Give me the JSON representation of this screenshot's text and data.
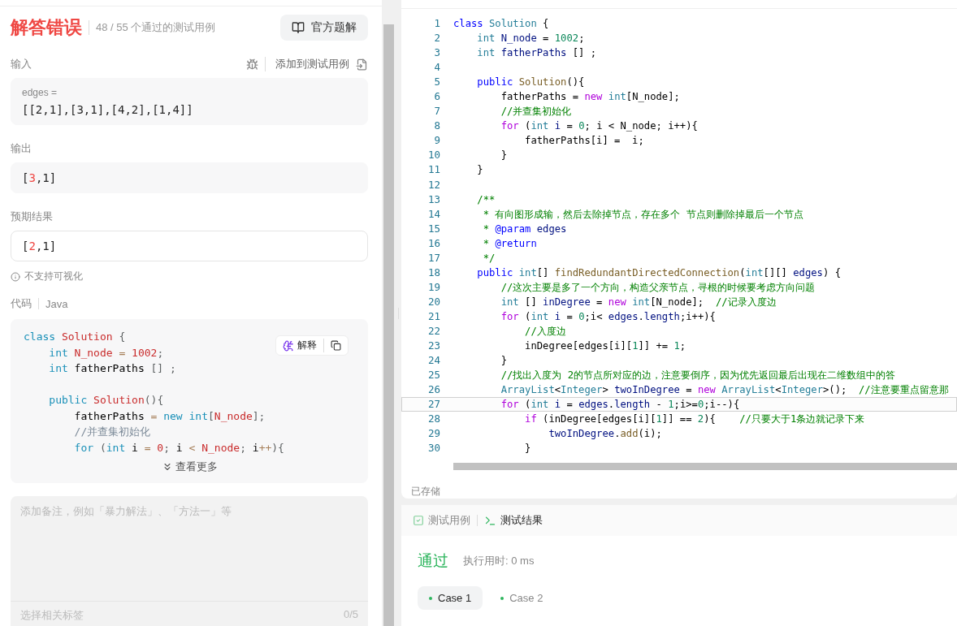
{
  "left": {
    "verdict": "解答错误",
    "passed": "48 / 55 个通过的测试用例",
    "solution_button": "官方题解",
    "input": {
      "label": "输入",
      "add_label": "添加到测试用例",
      "var": "edges =",
      "value": "[[2,1],[3,1],[4,2],[1,4]]"
    },
    "output": {
      "label": "输出",
      "parts": [
        {
          "text": "[",
          "wrong": false
        },
        {
          "text": "3",
          "wrong": true
        },
        {
          "text": ",1]",
          "wrong": false
        }
      ]
    },
    "expected": {
      "label": "预期结果",
      "parts": [
        {
          "text": "[",
          "wrong": false
        },
        {
          "text": "2",
          "wrong": true
        },
        {
          "text": ",1]",
          "wrong": false
        }
      ]
    },
    "no_visual": "不支持可视化",
    "code_label": "代码",
    "language": "Java",
    "explain_button": "解释",
    "snippet": [
      {
        "kind": "code",
        "tokens": [
          {
            "kind": "kw",
            "text": "class"
          },
          {
            "kind": "fn",
            "text": " Solution"
          },
          {
            "kind": "pn",
            "text": " {"
          }
        ]
      },
      {
        "kind": "code",
        "tokens": [
          {
            "kind": "kw",
            "text": "    int"
          },
          {
            "kind": "fn",
            "text": " N_node"
          },
          {
            "kind": "op",
            "text": " = "
          },
          {
            "kind": "num",
            "text": "1002"
          },
          {
            "kind": "pn",
            "text": ";"
          }
        ]
      },
      {
        "kind": "code",
        "tokens": [
          {
            "kind": "kw",
            "text": "    int"
          },
          {
            "kind": "p",
            "text": " fatherPaths "
          },
          {
            "kind": "pn",
            "text": "[] ;"
          }
        ]
      },
      {
        "kind": "blank"
      },
      {
        "kind": "code",
        "tokens": [
          {
            "kind": "kw",
            "text": "    public"
          },
          {
            "kind": "fn",
            "text": " Solution"
          },
          {
            "kind": "pn",
            "text": "(){"
          }
        ]
      },
      {
        "kind": "code",
        "tokens": [
          {
            "kind": "p",
            "text": "        fatherPaths "
          },
          {
            "kind": "op",
            "text": "="
          },
          {
            "kind": "kw",
            "text": " new"
          },
          {
            "kind": "kw",
            "text": " int"
          },
          {
            "kind": "pn",
            "text": "["
          },
          {
            "kind": "fn",
            "text": "N_node"
          },
          {
            "kind": "pn",
            "text": "];"
          }
        ]
      },
      {
        "kind": "code",
        "tokens": [
          {
            "kind": "cm",
            "text": "        //并查集初始化"
          }
        ]
      },
      {
        "kind": "code",
        "tokens": [
          {
            "kind": "kw",
            "text": "        for"
          },
          {
            "kind": "pn",
            "text": " ("
          },
          {
            "kind": "kw",
            "text": "int"
          },
          {
            "kind": "p",
            "text": " i "
          },
          {
            "kind": "op",
            "text": "="
          },
          {
            "kind": "num",
            "text": " 0"
          },
          {
            "kind": "pn",
            "text": ";"
          },
          {
            "kind": "p",
            "text": " i "
          },
          {
            "kind": "op",
            "text": "<"
          },
          {
            "kind": "fn",
            "text": " N_node"
          },
          {
            "kind": "pn",
            "text": ";"
          },
          {
            "kind": "p",
            "text": " i"
          },
          {
            "kind": "op",
            "text": "++"
          },
          {
            "kind": "pn",
            "text": "){"
          }
        ]
      }
    ],
    "more": "查看更多",
    "note_placeholder": "添加备注，例如「暴力解法」、「方法一」等",
    "tags_placeholder": "选择相关标签",
    "tags_count": "0/5"
  },
  "editor": {
    "lines": [
      {
        "num": "1",
        "highlighted": false,
        "tokens": [
          {
            "kind": "kw",
            "text": "class"
          },
          {
            "kind": "type",
            "text": " Solution"
          },
          {
            "kind": "p",
            "text": " {"
          }
        ]
      },
      {
        "num": "2",
        "highlighted": false,
        "tokens": [
          {
            "kind": "type",
            "text": "    int"
          },
          {
            "kind": "var",
            "text": " N_node"
          },
          {
            "kind": "p",
            "text": " = "
          },
          {
            "kind": "num",
            "text": "1002"
          },
          {
            "kind": "p",
            "text": ";"
          }
        ]
      },
      {
        "num": "3",
        "highlighted": false,
        "tokens": [
          {
            "kind": "type",
            "text": "    int"
          },
          {
            "kind": "var",
            "text": " fatherPaths"
          },
          {
            "kind": "p",
            "text": " [] ;"
          }
        ]
      },
      {
        "num": "4",
        "highlighted": false
      },
      {
        "num": "5",
        "highlighted": false,
        "tokens": [
          {
            "kind": "kw",
            "text": "    public"
          },
          {
            "kind": "fn",
            "text": " Solution"
          },
          {
            "kind": "p",
            "text": "(){"
          }
        ]
      },
      {
        "num": "6",
        "highlighted": false,
        "tokens": [
          {
            "kind": "p",
            "text": "        fatherPaths = "
          },
          {
            "kind": "ctl",
            "text": "new"
          },
          {
            "kind": "type",
            "text": " int"
          },
          {
            "kind": "p",
            "text": "[N_node];"
          }
        ]
      },
      {
        "num": "7",
        "highlighted": false,
        "tokens": [
          {
            "kind": "cm",
            "text": "        //并查集初始化"
          }
        ]
      },
      {
        "num": "8",
        "highlighted": false,
        "tokens": [
          {
            "kind": "ctl",
            "text": "        for"
          },
          {
            "kind": "p",
            "text": " ("
          },
          {
            "kind": "type",
            "text": "int"
          },
          {
            "kind": "var",
            "text": " i"
          },
          {
            "kind": "p",
            "text": " = "
          },
          {
            "kind": "num",
            "text": "0"
          },
          {
            "kind": "p",
            "text": "; i < N_node; i++){"
          }
        ]
      },
      {
        "num": "9",
        "highlighted": false,
        "tokens": [
          {
            "kind": "p",
            "text": "            fatherPaths[i] =  i;"
          }
        ]
      },
      {
        "num": "10",
        "highlighted": false,
        "tokens": [
          {
            "kind": "p",
            "text": "        }"
          }
        ]
      },
      {
        "num": "11",
        "highlighted": false,
        "tokens": [
          {
            "kind": "p",
            "text": "    }"
          }
        ]
      },
      {
        "num": "12",
        "highlighted": false
      },
      {
        "num": "13",
        "highlighted": false,
        "tokens": [
          {
            "kind": "cm",
            "text": "    /**"
          }
        ]
      },
      {
        "num": "14",
        "highlighted": false,
        "tokens": [
          {
            "kind": "cm",
            "text": "     * 有向图形成输，然后去除掉节点，存在多个 节点则删除掉最后一个节点"
          }
        ]
      },
      {
        "num": "15",
        "highlighted": false,
        "tokens": [
          {
            "kind": "cm",
            "text": "     * "
          },
          {
            "kind": "kw",
            "text": "@param"
          },
          {
            "kind": "var",
            "text": " edges"
          }
        ]
      },
      {
        "num": "16",
        "highlighted": false,
        "tokens": [
          {
            "kind": "cm",
            "text": "     * "
          },
          {
            "kind": "kw",
            "text": "@return"
          }
        ]
      },
      {
        "num": "17",
        "highlighted": false,
        "tokens": [
          {
            "kind": "cm",
            "text": "     */"
          }
        ]
      },
      {
        "num": "18",
        "highlighted": false,
        "tokens": [
          {
            "kind": "kw",
            "text": "    public"
          },
          {
            "kind": "type",
            "text": " int"
          },
          {
            "kind": "p",
            "text": "[] "
          },
          {
            "kind": "fn",
            "text": "findRedundantDirectedConnection"
          },
          {
            "kind": "p",
            "text": "("
          },
          {
            "kind": "type",
            "text": "int"
          },
          {
            "kind": "p",
            "text": "[][] "
          },
          {
            "kind": "var",
            "text": "edges"
          },
          {
            "kind": "p",
            "text": ") {"
          }
        ]
      },
      {
        "num": "19",
        "highlighted": false,
        "tokens": [
          {
            "kind": "cm",
            "text": "        //这次主要是多了一个方向，构造父亲节点，寻根的时候要考虑方向问题"
          }
        ]
      },
      {
        "num": "20",
        "highlighted": false,
        "tokens": [
          {
            "kind": "type",
            "text": "        int"
          },
          {
            "kind": "p",
            "text": " [] "
          },
          {
            "kind": "var",
            "text": "inDegree"
          },
          {
            "kind": "p",
            "text": " = "
          },
          {
            "kind": "ctl",
            "text": "new"
          },
          {
            "kind": "type",
            "text": " int"
          },
          {
            "kind": "p",
            "text": "[N_node];"
          },
          {
            "kind": "cm",
            "text": "  //记录入度边"
          }
        ]
      },
      {
        "num": "21",
        "highlighted": false,
        "tokens": [
          {
            "kind": "ctl",
            "text": "        for"
          },
          {
            "kind": "p",
            "text": " ("
          },
          {
            "kind": "type",
            "text": "int"
          },
          {
            "kind": "var",
            "text": " i"
          },
          {
            "kind": "p",
            "text": " = "
          },
          {
            "kind": "num",
            "text": "0"
          },
          {
            "kind": "p",
            "text": ";i< "
          },
          {
            "kind": "var",
            "text": "edges"
          },
          {
            "kind": "p",
            "text": "."
          },
          {
            "kind": "var",
            "text": "length"
          },
          {
            "kind": "p",
            "text": ";i++){"
          }
        ]
      },
      {
        "num": "22",
        "highlighted": false,
        "tokens": [
          {
            "kind": "cm",
            "text": "            //入度边"
          }
        ]
      },
      {
        "num": "23",
        "highlighted": false,
        "tokens": [
          {
            "kind": "p",
            "text": "            inDegree[edges[i]["
          },
          {
            "kind": "num",
            "text": "1"
          },
          {
            "kind": "p",
            "text": "]] += "
          },
          {
            "kind": "num",
            "text": "1"
          },
          {
            "kind": "p",
            "text": ";"
          }
        ]
      },
      {
        "num": "24",
        "highlighted": false,
        "tokens": [
          {
            "kind": "p",
            "text": "        }"
          }
        ]
      },
      {
        "num": "25",
        "highlighted": false,
        "tokens": [
          {
            "kind": "cm",
            "text": "        //找出入度为 2的节点所对应的边，注意要倒序，因为优先返回最后出现在二维数组中的答"
          }
        ]
      },
      {
        "num": "26",
        "highlighted": false,
        "tokens": [
          {
            "kind": "type",
            "text": "        ArrayList"
          },
          {
            "kind": "p",
            "text": "<"
          },
          {
            "kind": "type",
            "text": "Integer"
          },
          {
            "kind": "p",
            "text": "> "
          },
          {
            "kind": "var",
            "text": "twoInDegree"
          },
          {
            "kind": "p",
            "text": " = "
          },
          {
            "kind": "ctl",
            "text": "new"
          },
          {
            "kind": "type",
            "text": " ArrayList"
          },
          {
            "kind": "p",
            "text": "<"
          },
          {
            "kind": "type",
            "text": "Integer"
          },
          {
            "kind": "p",
            "text": ">();"
          },
          {
            "kind": "cm",
            "text": "  //注意要重点留意那"
          }
        ]
      },
      {
        "num": "27",
        "highlighted": true,
        "tokens": [
          {
            "kind": "ctl",
            "text": "        for"
          },
          {
            "kind": "p",
            "text": " ("
          },
          {
            "kind": "type",
            "text": "int"
          },
          {
            "kind": "var",
            "text": " i"
          },
          {
            "kind": "p",
            "text": " = "
          },
          {
            "kind": "var",
            "text": "edges"
          },
          {
            "kind": "p",
            "text": "."
          },
          {
            "kind": "var",
            "text": "length"
          },
          {
            "kind": "p",
            "text": " - "
          },
          {
            "kind": "num",
            "text": "1"
          },
          {
            "kind": "p",
            "text": ";i>="
          },
          {
            "kind": "num",
            "text": "0"
          },
          {
            "kind": "p",
            "text": ";i--){"
          }
        ]
      },
      {
        "num": "28",
        "highlighted": false,
        "tokens": [
          {
            "kind": "ctl",
            "text": "            if"
          },
          {
            "kind": "p",
            "text": " (inDegree[edges[i]["
          },
          {
            "kind": "num",
            "text": "1"
          },
          {
            "kind": "p",
            "text": "]] == "
          },
          {
            "kind": "num",
            "text": "2"
          },
          {
            "kind": "p",
            "text": "){"
          },
          {
            "kind": "cm",
            "text": "    //只要大于1条边就记录下来"
          }
        ]
      },
      {
        "num": "29",
        "highlighted": false,
        "tokens": [
          {
            "kind": "var",
            "text": "                twoInDegree"
          },
          {
            "kind": "p",
            "text": "."
          },
          {
            "kind": "fn",
            "text": "add"
          },
          {
            "kind": "p",
            "text": "(i);"
          }
        ]
      },
      {
        "num": "30",
        "highlighted": false,
        "tokens": [
          {
            "kind": "p",
            "text": "            }"
          }
        ]
      }
    ],
    "status": "已存储"
  },
  "results": {
    "tabs": [
      {
        "label": "测试用例",
        "selected": false
      },
      {
        "label": "测试结果",
        "selected": true
      }
    ],
    "status": "通过",
    "runtime": "执行用时: 0 ms",
    "cases": [
      {
        "label": "Case 1",
        "selected": true
      },
      {
        "label": "Case 2",
        "selected": false
      }
    ]
  }
}
